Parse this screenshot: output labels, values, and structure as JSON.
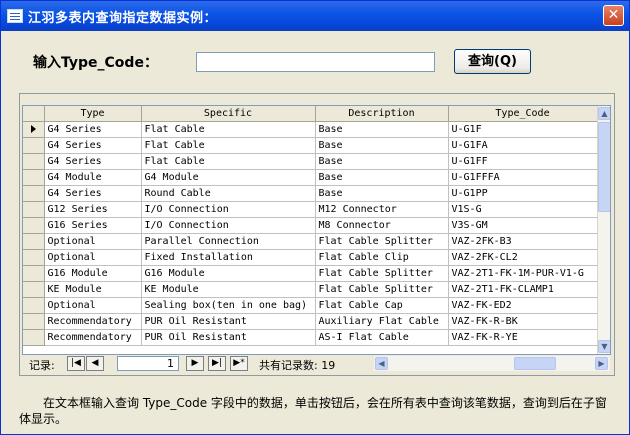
{
  "window": {
    "title": "江羽多表内查询指定数据实例：",
    "close_glyph": "✕"
  },
  "form": {
    "input_label": "输入Type_Code：",
    "input_value": "",
    "query_button": "查询(Q)"
  },
  "datasheet": {
    "columns": [
      "Type",
      "Specific",
      "Description",
      "Type_Code"
    ],
    "rows": [
      [
        "G4 Series",
        "Flat Cable",
        "Base",
        "U-G1F"
      ],
      [
        "G4 Series",
        "Flat Cable",
        "Base",
        "U-G1FA"
      ],
      [
        "G4 Series",
        "Flat Cable",
        "Base",
        "U-G1FF"
      ],
      [
        "G4 Module",
        "G4 Module",
        "Base",
        "U-G1FFFA"
      ],
      [
        "G4 Series",
        "Round Cable",
        "Base",
        "U-G1PP"
      ],
      [
        "G12 Series",
        "I/O Connection",
        "M12 Connector",
        "V1S-G"
      ],
      [
        "G16 Series",
        "I/O Connection",
        "M8 Connector",
        "V3S-GM"
      ],
      [
        "Optional",
        "Parallel Connection",
        "Flat Cable Splitter",
        "VAZ-2FK-B3"
      ],
      [
        "Optional",
        "Fixed Installation",
        "Flat Cable Clip",
        "VAZ-2FK-CL2"
      ],
      [
        "G16 Module",
        "G16 Module",
        "Flat Cable Splitter",
        "VAZ-2T1-FK-1M-PUR-V1-G"
      ],
      [
        "KE Module",
        "KE Module",
        "Flat Cable Splitter",
        "VAZ-2T1-FK-CLAMP1"
      ],
      [
        "Optional",
        "Sealing box(ten in one bag)",
        "Flat Cable Cap",
        "VAZ-FK-ED2"
      ],
      [
        "Recommendatory",
        "PUR Oil Resistant",
        "Auxiliary Flat Cable",
        "VAZ-FK-R-BK"
      ],
      [
        "Recommendatory",
        "PUR Oil Resistant",
        "AS-I Flat Cable",
        "VAZ-FK-R-YE"
      ]
    ],
    "current_row_marker": "record-selector-arrow"
  },
  "navigation": {
    "label": "记录:",
    "current_record": "1",
    "total_text": "共有记录数: 19",
    "first_glyph": "|◀",
    "prev_glyph": "◀",
    "next_glyph": "▶",
    "last_glyph": "▶|",
    "new_glyph": "▶*"
  },
  "note": "在文本框输入查询 Type_Code 字段中的数据，单击按钮后，会在所有表中查询该笔数据，查询到后在子窗体显示。",
  "colors": {
    "title_bar": "#0a53e6",
    "window_bg": "#ece9d8",
    "grid_bg": "#ffffff"
  }
}
